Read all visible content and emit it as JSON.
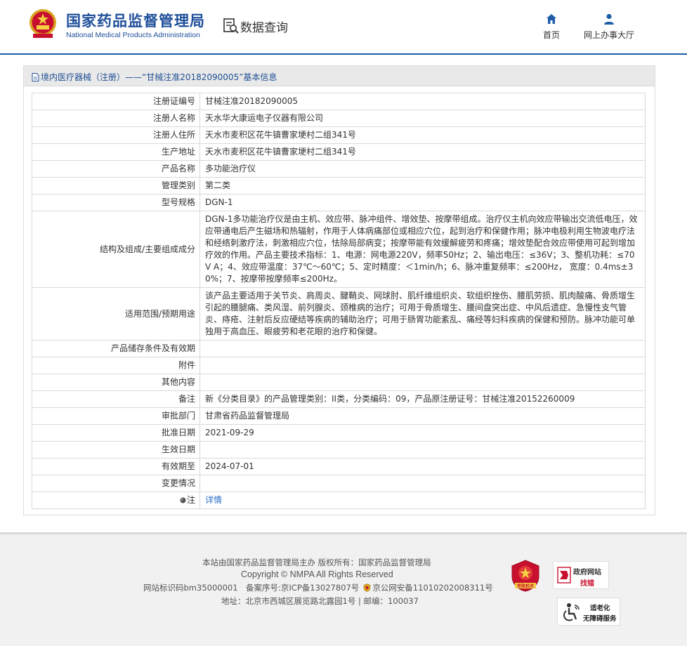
{
  "header": {
    "brand_cn": "国家药品监督管理局",
    "brand_en": "National Medical Products Administration",
    "page_title": "数据查询",
    "nav": [
      {
        "label": "首页",
        "icon": "home-icon"
      },
      {
        "label": "网上办事大厅",
        "icon": "user-icon"
      }
    ]
  },
  "breadcrumb": {
    "text": "境内医疗器械（注册）——“甘械注准20182090005”基本信息"
  },
  "rows": [
    {
      "label": "注册证编号",
      "value": "甘械注准20182090005"
    },
    {
      "label": "注册人名称",
      "value": "天水华大康运电子仪器有限公司"
    },
    {
      "label": "注册人住所",
      "value": "天水市麦积区花牛镇曹家埂村二组341号"
    },
    {
      "label": "生产地址",
      "value": "天水市麦积区花牛镇曹家埂村二组341号"
    },
    {
      "label": "产品名称",
      "value": "多功能治疗仪"
    },
    {
      "label": "管理类别",
      "value": "第二类"
    },
    {
      "label": "型号规格",
      "value": "DGN-1"
    },
    {
      "label": "结构及组成/主要组成成分",
      "value": "DGN-1多功能治疗仪是由主机、效应带、脉冲组件、增效垫、按摩带组成。治疗仪主机向效应带输出交流低电压，效应带通电后产生磁场和热辐射，作用于人体病痛部位或相应穴位，起到治疗和保健作用；脉冲电极利用生物波电疗法和经络刺激疗法，刺激相应穴位，怯除局部病变；按摩带能有效缓解疲劳和疼痛；增效垫配合效应带使用可起到增加疗效的作用。产品主要技术指标：1、电源：网电源220V，频率50Hz；2、输出电压：≤36V；3、整机功耗：≤70V A；4、效应带温度：37℃～60℃；5、定时精度：＜1min/h；6、脉冲重复频率：≤200Hz， 宽度：0.4ms±30%；7、按摩带按摩频率≤200Hz。"
    },
    {
      "label": "适用范围/预期用途",
      "value": "该产品主要适用于关节炎、肩周炎、腱鞘炎、网球肘、肌纤维组织炎、软组织挫伤、腰肌劳损、肌肉酸痛、骨质增生引起的腰腿痛、类风湿、前列腺炎、颈椎病的治疗；可用于骨质增生、腰间盘突出症、中风后遗症、急慢性支气管炎、痔疮、注射后反应硬结等疾病的辅助治疗；可用于肠胃功能紊乱、痛经等妇科疾病的保健和预防。脉冲功能可单独用于高血压、眼疲劳和老花眼的治疗和保健。"
    },
    {
      "label": "产品储存条件及有效期",
      "value": ""
    },
    {
      "label": "附件",
      "value": ""
    },
    {
      "label": "其他内容",
      "value": ""
    },
    {
      "label": "备注",
      "value": "新《分类目录》的产品管理类别：II类，分类编码：09，产品原注册证号：甘械注准20152260009"
    },
    {
      "label": "审批部门",
      "value": "甘肃省药品监督管理局"
    },
    {
      "label": "批准日期",
      "value": "2021-09-29"
    },
    {
      "label": "生效日期",
      "value": ""
    },
    {
      "label": "有效期至",
      "value": "2024-07-01"
    },
    {
      "label": "变更情况",
      "value": ""
    }
  ],
  "note": {
    "label": "注",
    "link": "详情"
  },
  "footer": {
    "line1": "本站由国家药品监督管理局主办 版权所有：国家药品监督管理局",
    "line2": "Copyright © NMPA All Rights Reserved",
    "line3a": "网站标识码bm35000001　备案序号:京ICP备13027807号",
    "line3b": "京公网安备11010202008311号",
    "line4": "地址：北京市西城区展览路北露园1号 | 邮编：100037",
    "badge_party": "党政机关",
    "badge_gov_1": "政府网站",
    "badge_gov_2": "找错",
    "badge_acc_1": "适老化",
    "badge_acc_2": "无障碍服务"
  },
  "colors": {
    "brand": "#1f4f9a",
    "link": "#2a6ec9",
    "accent_red": "#c8102e"
  }
}
